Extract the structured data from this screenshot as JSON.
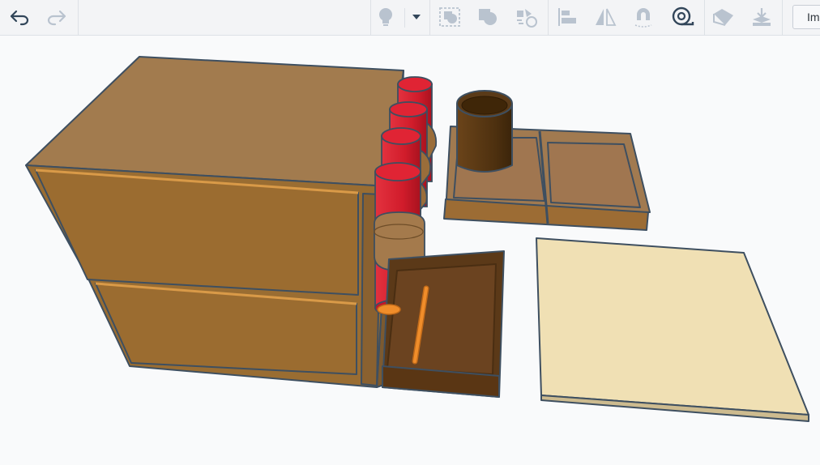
{
  "toolbar": {
    "undo_icon": "undo-arrow-icon",
    "redo_icon": "redo-arrow-icon",
    "light_icon": "lightbulb-icon",
    "dropdown_icon": "caret-down-icon",
    "group_icon": "group-icon",
    "ungroup_icon": "ungroup-icon",
    "cruise_icon": "cruise-icon",
    "align_icon": "align-icon",
    "mirror_icon": "mirror-icon",
    "magnet_icon": "magnet-icon",
    "ruler_icon": "ruler-tape-icon",
    "flag_icon": "tag-icon",
    "drop_icon": "drop-to-plane-icon",
    "import_label": "Im"
  },
  "colors": {
    "toolbar_bg": "#f3f4f6",
    "icon_disabled": "#b9c3cf",
    "icon_active": "#32465a",
    "cabinet_light": "#a27b4e",
    "cabinet_front": "#9a6d32",
    "cylinder_red": "#d81f2e",
    "tray_dark": "#5b3918",
    "panel_beige": "#f0e0b4",
    "outline": "#3e4f60"
  }
}
